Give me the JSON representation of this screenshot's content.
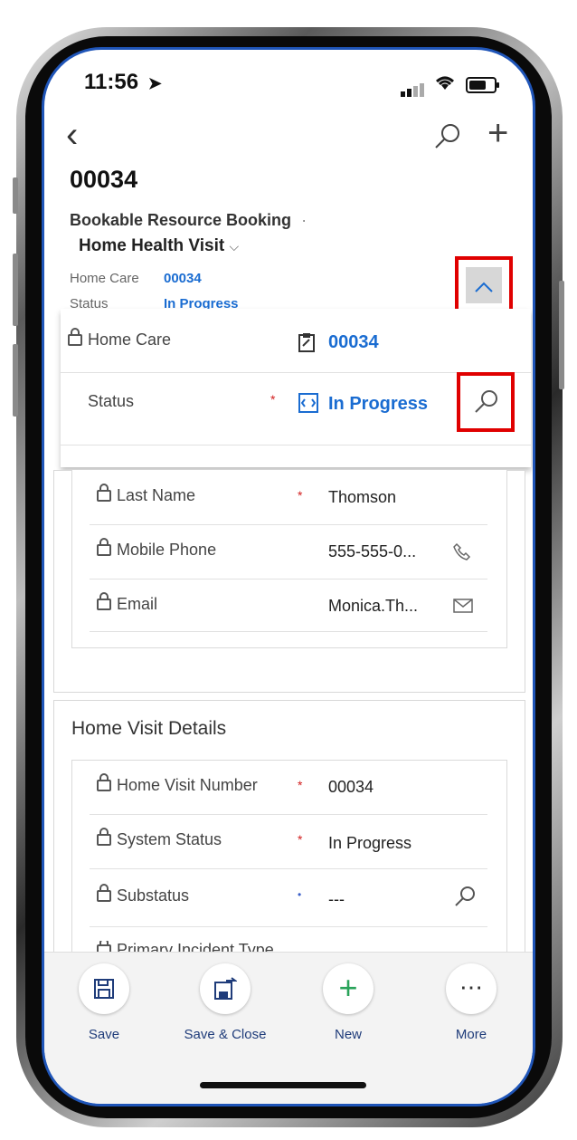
{
  "statusbar": {
    "time": "11:56",
    "location_glyph": "➤"
  },
  "nav": {
    "back_glyph": "‹",
    "plus_glyph": "+"
  },
  "record": {
    "title": "00034",
    "entity": "Bookable Resource Booking",
    "entity_sep": "·",
    "form_name": "Home Health Visit",
    "form_chevron": "⌵"
  },
  "header_fields": [
    {
      "label": "Home Care",
      "value": "00034"
    },
    {
      "label": "Status",
      "value": "In Progress"
    }
  ],
  "flyout": {
    "home_care_label": "Home Care",
    "home_care_value": "00034",
    "status_label": "Status",
    "status_required": "*",
    "status_value": "In Progress"
  },
  "contact_card": {
    "rows": [
      {
        "label": "Last Name",
        "required": "*",
        "value": "Thomson"
      },
      {
        "label": "Mobile Phone",
        "required": "",
        "value": "555-555-0..."
      },
      {
        "label": "Email",
        "required": "",
        "value": "Monica.Th..."
      }
    ]
  },
  "visit_section": {
    "title": "Home Visit Details",
    "rows": [
      {
        "label": "Home Visit Number",
        "required": "*",
        "value": "00034"
      },
      {
        "label": "System Status",
        "required": "*",
        "value": "In Progress"
      },
      {
        "label": "Substatus",
        "required": "•",
        "value": "---"
      },
      {
        "label": "Primary Incident Type",
        "required": "",
        "value": ""
      }
    ]
  },
  "footer": {
    "save": "Save",
    "save_close": "Save & Close",
    "new": "New",
    "more": "More",
    "more_glyph": "⋯",
    "new_glyph": "+"
  },
  "colors": {
    "accent": "#1a6cd1",
    "highlight_border": "#e00000",
    "required": "#d21e1e"
  }
}
